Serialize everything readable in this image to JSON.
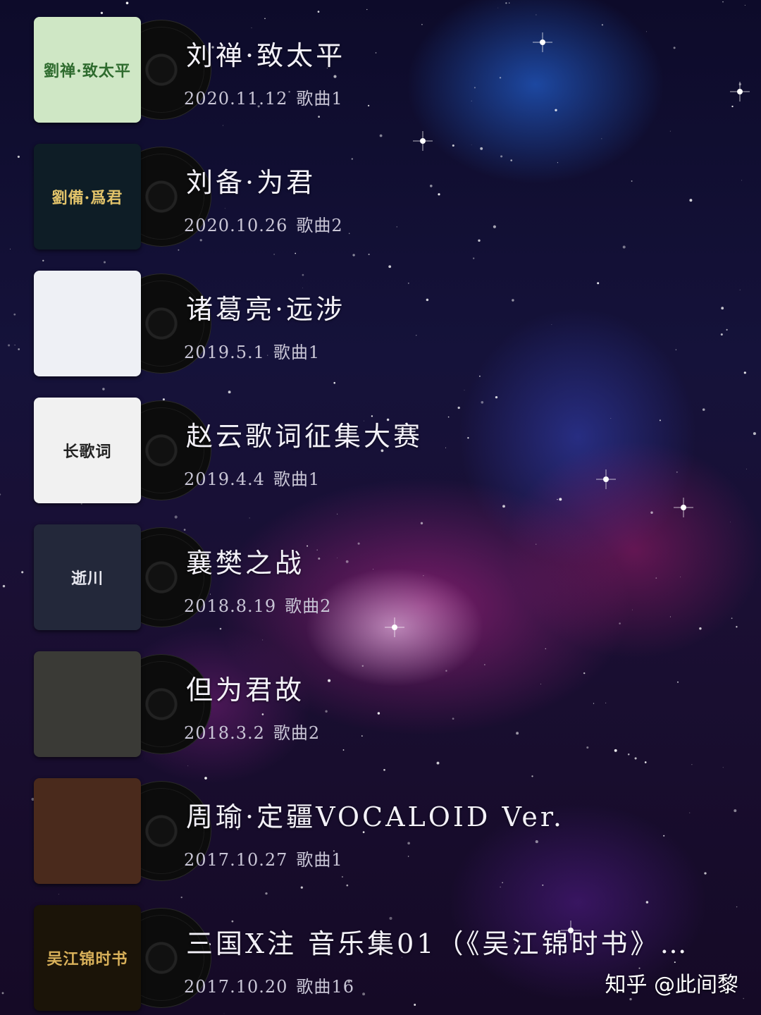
{
  "songs": [
    {
      "title": "刘禅·致太平",
      "date": "2020.11.12",
      "count": "歌曲1",
      "cover_text": "劉禅·致太平",
      "cover_bg": "#cfe7c5",
      "cover_fg": "#2e6b2e"
    },
    {
      "title": "刘备·为君",
      "date": "2020.10.26",
      "count": "歌曲2",
      "cover_text": "劉備·爲君",
      "cover_bg": "#0e1d26",
      "cover_fg": "#e2c36a"
    },
    {
      "title": "诸葛亮·远涉",
      "date": "2019.5.1",
      "count": "歌曲1",
      "cover_text": "",
      "cover_bg": "#eef0f5",
      "cover_fg": "#4b5a86"
    },
    {
      "title": "赵云歌词征集大赛",
      "date": "2019.4.4",
      "count": "歌曲1",
      "cover_text": "长歌词",
      "cover_bg": "#f1f1f1",
      "cover_fg": "#222222"
    },
    {
      "title": "襄樊之战",
      "date": "2018.8.19",
      "count": "歌曲2",
      "cover_text": "逝川",
      "cover_bg": "#23283a",
      "cover_fg": "#e8e8f0"
    },
    {
      "title": "但为君故",
      "date": "2018.3.2",
      "count": "歌曲2",
      "cover_text": "",
      "cover_bg": "#3a3a36",
      "cover_fg": "#cccccc"
    },
    {
      "title": "周瑜·定疆VOCALOID Ver.",
      "date": "2017.10.27",
      "count": "歌曲1",
      "cover_text": "",
      "cover_bg": "#4a2a1c",
      "cover_fg": "#e0b070"
    },
    {
      "title": "三国X注 音乐集01（《吴江锦时书》…",
      "date": "2017.10.20",
      "count": "歌曲16",
      "cover_text": "吴江锦时书",
      "cover_bg": "#1b1408",
      "cover_fg": "#d9b15a"
    }
  ],
  "watermark": "知乎 @此间黎"
}
